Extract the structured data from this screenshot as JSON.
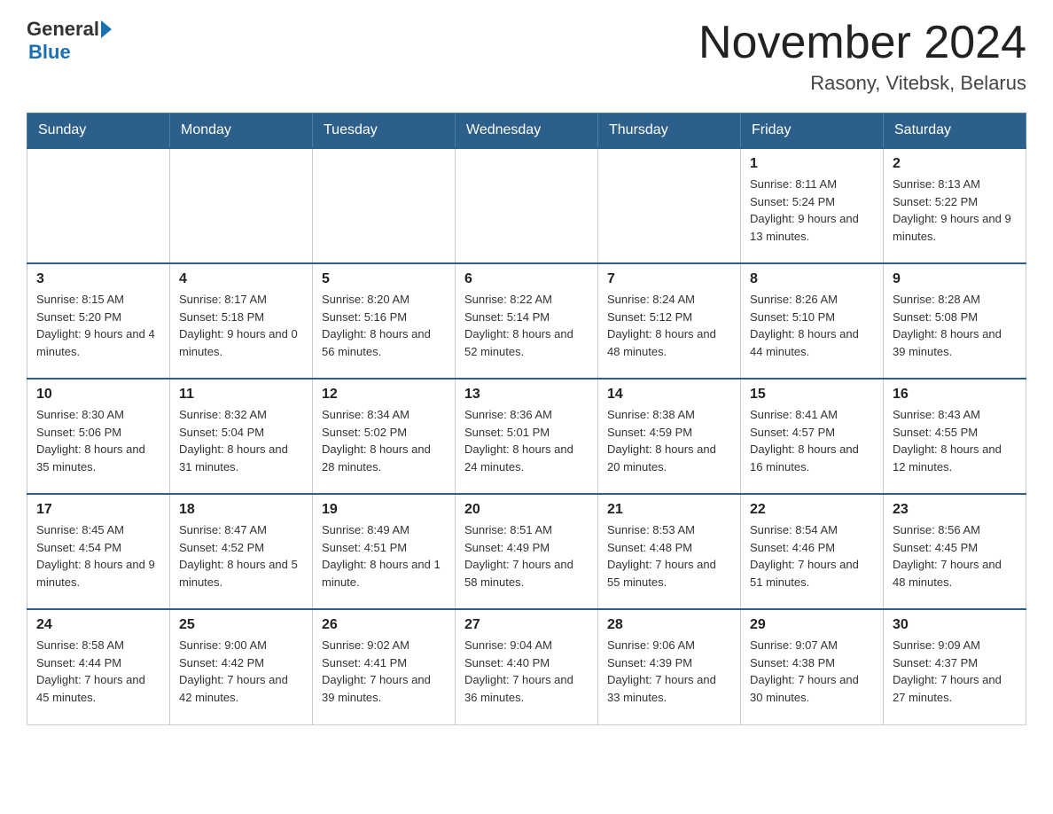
{
  "header": {
    "logo_general": "General",
    "logo_blue": "Blue",
    "month_title": "November 2024",
    "location": "Rasony, Vitebsk, Belarus"
  },
  "weekdays": [
    "Sunday",
    "Monday",
    "Tuesday",
    "Wednesday",
    "Thursday",
    "Friday",
    "Saturday"
  ],
  "weeks": [
    {
      "days": [
        {
          "number": "",
          "info": "",
          "empty": true
        },
        {
          "number": "",
          "info": "",
          "empty": true
        },
        {
          "number": "",
          "info": "",
          "empty": true
        },
        {
          "number": "",
          "info": "",
          "empty": true
        },
        {
          "number": "",
          "info": "",
          "empty": true
        },
        {
          "number": "1",
          "info": "Sunrise: 8:11 AM\nSunset: 5:24 PM\nDaylight: 9 hours and 13 minutes."
        },
        {
          "number": "2",
          "info": "Sunrise: 8:13 AM\nSunset: 5:22 PM\nDaylight: 9 hours and 9 minutes."
        }
      ]
    },
    {
      "days": [
        {
          "number": "3",
          "info": "Sunrise: 8:15 AM\nSunset: 5:20 PM\nDaylight: 9 hours and 4 minutes."
        },
        {
          "number": "4",
          "info": "Sunrise: 8:17 AM\nSunset: 5:18 PM\nDaylight: 9 hours and 0 minutes."
        },
        {
          "number": "5",
          "info": "Sunrise: 8:20 AM\nSunset: 5:16 PM\nDaylight: 8 hours and 56 minutes."
        },
        {
          "number": "6",
          "info": "Sunrise: 8:22 AM\nSunset: 5:14 PM\nDaylight: 8 hours and 52 minutes."
        },
        {
          "number": "7",
          "info": "Sunrise: 8:24 AM\nSunset: 5:12 PM\nDaylight: 8 hours and 48 minutes."
        },
        {
          "number": "8",
          "info": "Sunrise: 8:26 AM\nSunset: 5:10 PM\nDaylight: 8 hours and 44 minutes."
        },
        {
          "number": "9",
          "info": "Sunrise: 8:28 AM\nSunset: 5:08 PM\nDaylight: 8 hours and 39 minutes."
        }
      ]
    },
    {
      "days": [
        {
          "number": "10",
          "info": "Sunrise: 8:30 AM\nSunset: 5:06 PM\nDaylight: 8 hours and 35 minutes."
        },
        {
          "number": "11",
          "info": "Sunrise: 8:32 AM\nSunset: 5:04 PM\nDaylight: 8 hours and 31 minutes."
        },
        {
          "number": "12",
          "info": "Sunrise: 8:34 AM\nSunset: 5:02 PM\nDaylight: 8 hours and 28 minutes."
        },
        {
          "number": "13",
          "info": "Sunrise: 8:36 AM\nSunset: 5:01 PM\nDaylight: 8 hours and 24 minutes."
        },
        {
          "number": "14",
          "info": "Sunrise: 8:38 AM\nSunset: 4:59 PM\nDaylight: 8 hours and 20 minutes."
        },
        {
          "number": "15",
          "info": "Sunrise: 8:41 AM\nSunset: 4:57 PM\nDaylight: 8 hours and 16 minutes."
        },
        {
          "number": "16",
          "info": "Sunrise: 8:43 AM\nSunset: 4:55 PM\nDaylight: 8 hours and 12 minutes."
        }
      ]
    },
    {
      "days": [
        {
          "number": "17",
          "info": "Sunrise: 8:45 AM\nSunset: 4:54 PM\nDaylight: 8 hours and 9 minutes."
        },
        {
          "number": "18",
          "info": "Sunrise: 8:47 AM\nSunset: 4:52 PM\nDaylight: 8 hours and 5 minutes."
        },
        {
          "number": "19",
          "info": "Sunrise: 8:49 AM\nSunset: 4:51 PM\nDaylight: 8 hours and 1 minute."
        },
        {
          "number": "20",
          "info": "Sunrise: 8:51 AM\nSunset: 4:49 PM\nDaylight: 7 hours and 58 minutes."
        },
        {
          "number": "21",
          "info": "Sunrise: 8:53 AM\nSunset: 4:48 PM\nDaylight: 7 hours and 55 minutes."
        },
        {
          "number": "22",
          "info": "Sunrise: 8:54 AM\nSunset: 4:46 PM\nDaylight: 7 hours and 51 minutes."
        },
        {
          "number": "23",
          "info": "Sunrise: 8:56 AM\nSunset: 4:45 PM\nDaylight: 7 hours and 48 minutes."
        }
      ]
    },
    {
      "days": [
        {
          "number": "24",
          "info": "Sunrise: 8:58 AM\nSunset: 4:44 PM\nDaylight: 7 hours and 45 minutes."
        },
        {
          "number": "25",
          "info": "Sunrise: 9:00 AM\nSunset: 4:42 PM\nDaylight: 7 hours and 42 minutes."
        },
        {
          "number": "26",
          "info": "Sunrise: 9:02 AM\nSunset: 4:41 PM\nDaylight: 7 hours and 39 minutes."
        },
        {
          "number": "27",
          "info": "Sunrise: 9:04 AM\nSunset: 4:40 PM\nDaylight: 7 hours and 36 minutes."
        },
        {
          "number": "28",
          "info": "Sunrise: 9:06 AM\nSunset: 4:39 PM\nDaylight: 7 hours and 33 minutes."
        },
        {
          "number": "29",
          "info": "Sunrise: 9:07 AM\nSunset: 4:38 PM\nDaylight: 7 hours and 30 minutes."
        },
        {
          "number": "30",
          "info": "Sunrise: 9:09 AM\nSunset: 4:37 PM\nDaylight: 7 hours and 27 minutes."
        }
      ]
    }
  ]
}
